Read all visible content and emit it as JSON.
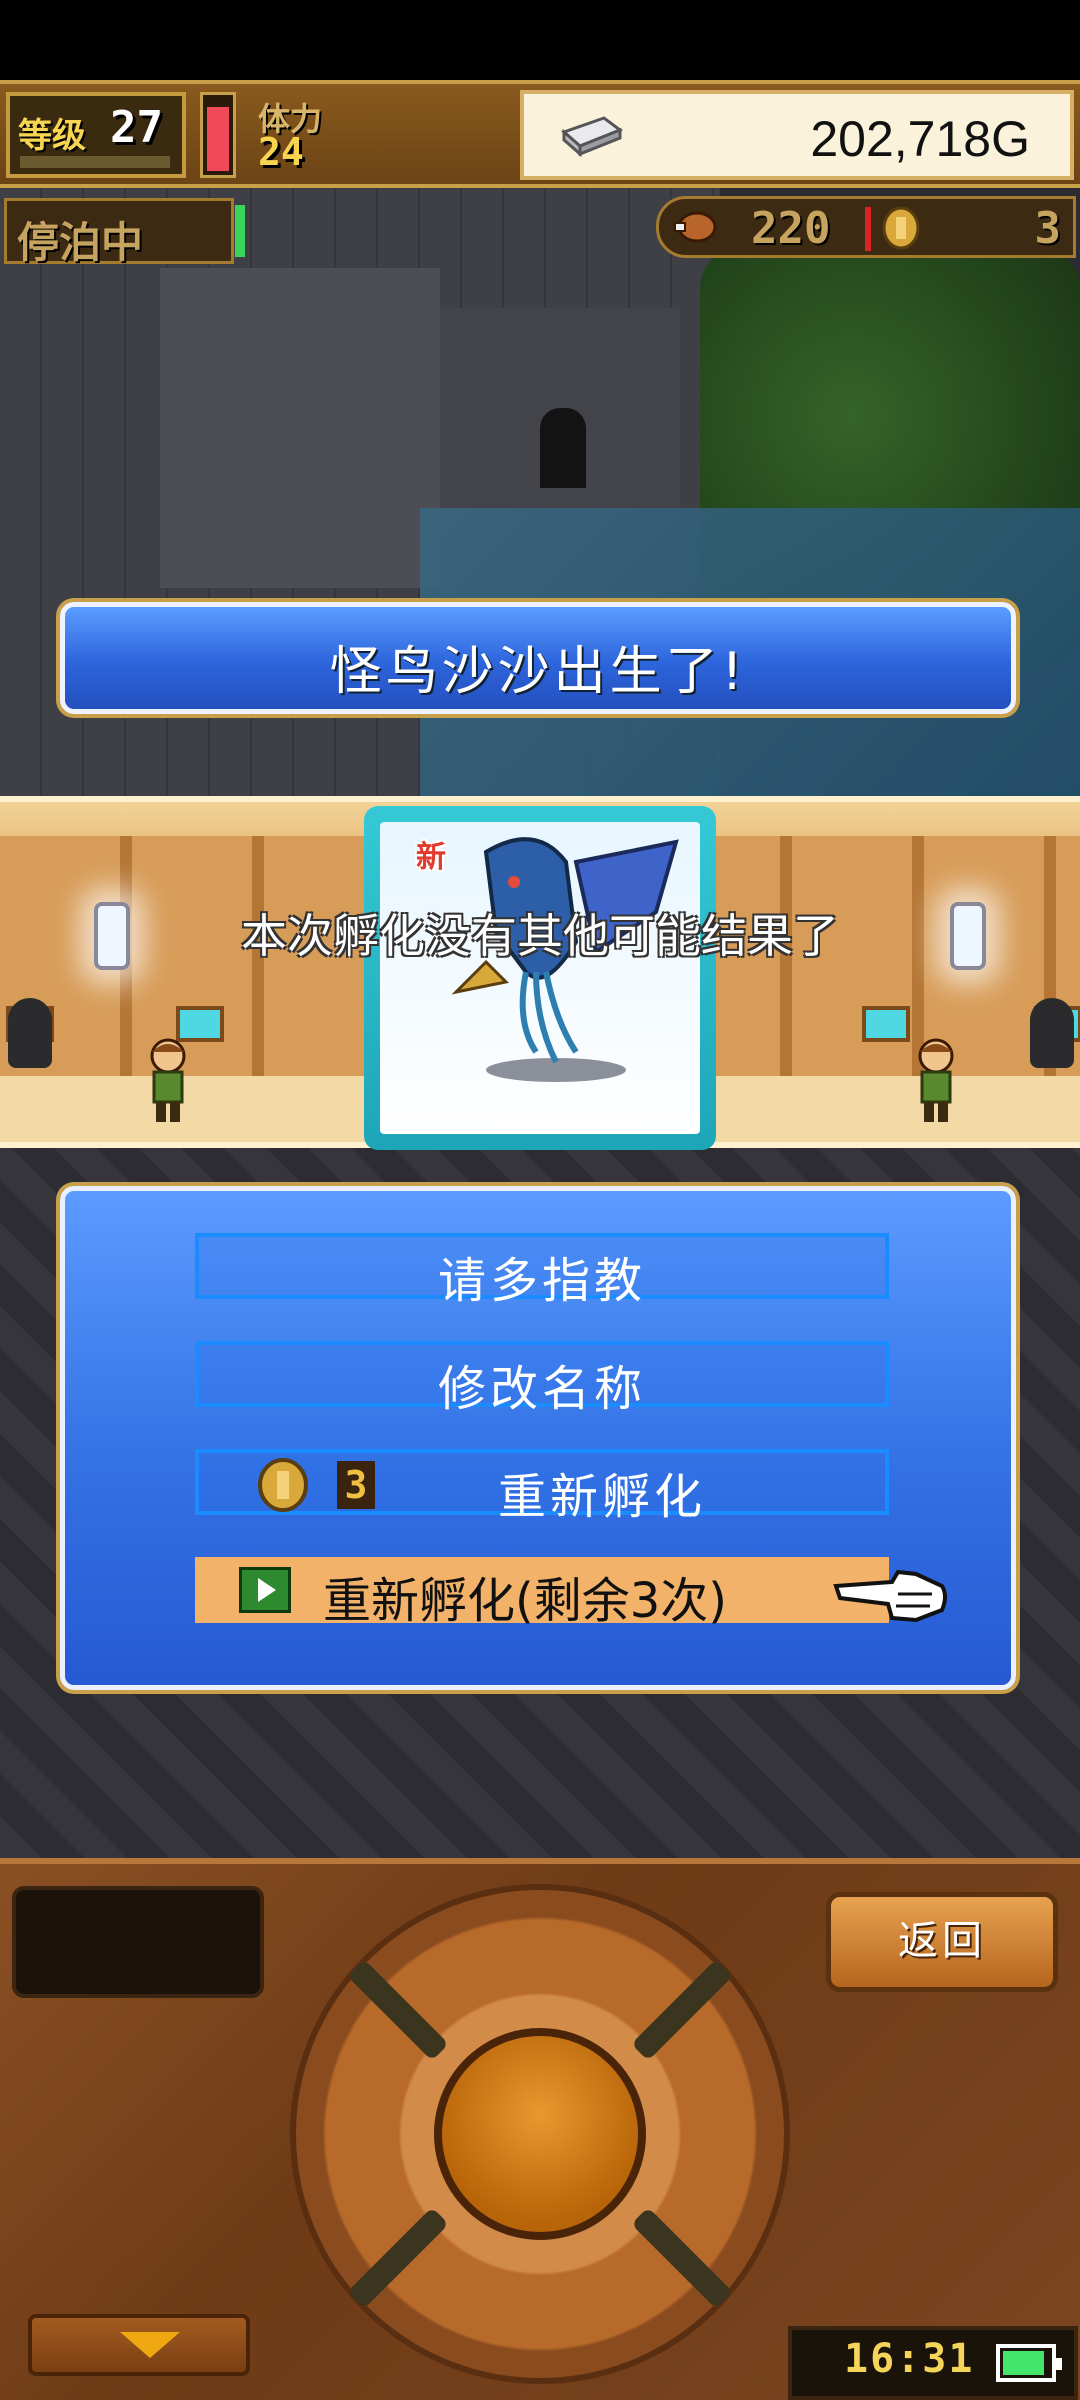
{
  "header": {
    "level_label": "等级",
    "level": "27",
    "stamina_label": "体力",
    "stamina": "24",
    "stamina_fill_fraction": 0.9,
    "gold": "202,718G",
    "moor_status": "停泊中",
    "food": "220",
    "coins": "3"
  },
  "banner": {
    "text": "怪鸟沙沙出生了!"
  },
  "hatch": {
    "new_badge": "新",
    "message": "本次孵化没有其他可能结果了"
  },
  "menu": {
    "items": [
      {
        "label": "请多指教"
      },
      {
        "label": "修改名称"
      },
      {
        "label": "重新孵化",
        "cost": "3"
      },
      {
        "label": "重新孵化(剩余3次)"
      }
    ]
  },
  "controller": {
    "back_label": "返回",
    "clock": "16:31",
    "battery_fraction": 0.9
  },
  "colors": {
    "panel_blue": "#3575e6",
    "menu_highlight": "#f2b26a",
    "stamina_red": "#f04a5a",
    "gold_text": "#f7d550"
  }
}
